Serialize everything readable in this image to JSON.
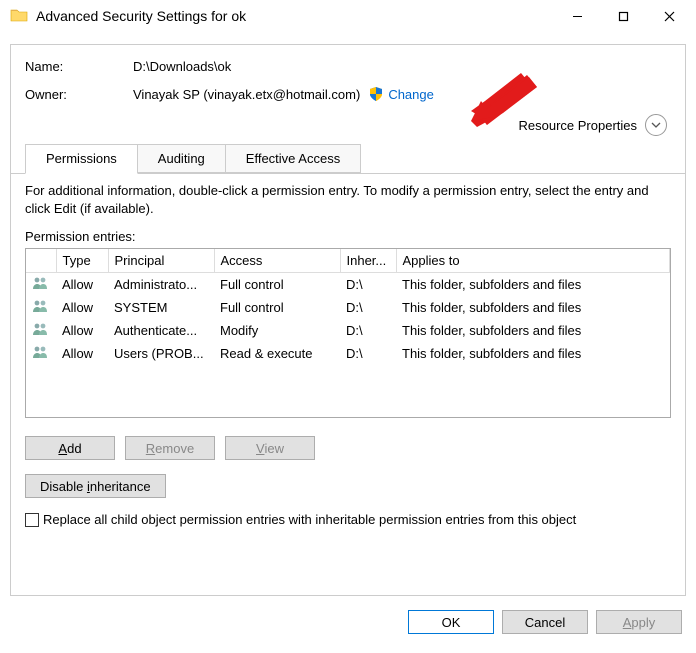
{
  "window": {
    "title": "Advanced Security Settings for ok"
  },
  "fields": {
    "name_label": "Name:",
    "name_value": "D:\\Downloads\\ok",
    "owner_label": "Owner:",
    "owner_value": "Vinayak SP (vinayak.etx@hotmail.com)",
    "change_link": "Change",
    "resource_properties": "Resource Properties"
  },
  "tabs": {
    "permissions": "Permissions",
    "auditing": "Auditing",
    "effective": "Effective Access"
  },
  "info": "For additional information, double-click a permission entry. To modify a permission entry, select the entry and click Edit (if available).",
  "entries_label": "Permission entries:",
  "columns": {
    "type": "Type",
    "principal": "Principal",
    "access": "Access",
    "inherited": "Inher...",
    "applies": "Applies to"
  },
  "rows": [
    {
      "type": "Allow",
      "principal": "Administrato...",
      "access": "Full control",
      "inherited": "D:\\",
      "applies": "This folder, subfolders and files"
    },
    {
      "type": "Allow",
      "principal": "SYSTEM",
      "access": "Full control",
      "inherited": "D:\\",
      "applies": "This folder, subfolders and files"
    },
    {
      "type": "Allow",
      "principal": "Authenticate...",
      "access": "Modify",
      "inherited": "D:\\",
      "applies": "This folder, subfolders and files"
    },
    {
      "type": "Allow",
      "principal": "Users (PROB...",
      "access": "Read & execute",
      "inherited": "D:\\",
      "applies": "This folder, subfolders and files"
    }
  ],
  "buttons": {
    "add": "Add",
    "remove": "Remove",
    "view": "View",
    "disable": "Disable inheritance",
    "ok": "OK",
    "cancel": "Cancel",
    "apply": "Apply"
  },
  "checkbox": {
    "replace": "Replace all child object permission entries with inheritable permission entries from this object"
  }
}
